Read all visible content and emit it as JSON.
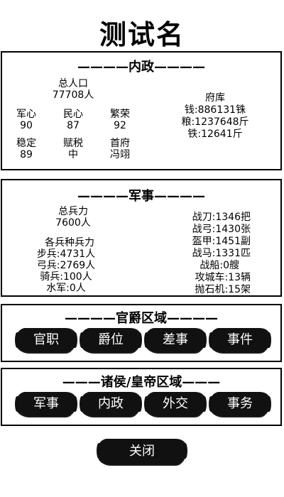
{
  "title": "测试名",
  "neizheng": {
    "header": "————内政————",
    "population_label": "总人口",
    "population_value": "77708人",
    "stats": [
      {
        "label": "军心",
        "value": "90"
      },
      {
        "label": "民心",
        "value": "87"
      },
      {
        "label": "繁荣",
        "value": "92"
      },
      {
        "label": "稳定",
        "value": "89"
      },
      {
        "label": "赋税",
        "value": "中"
      },
      {
        "label": "首府",
        "value": "冯翊"
      }
    ],
    "treasury_label": "府库",
    "treasury": [
      "钱:886131铢",
      "粮:1237648斤",
      "铁:12641斤"
    ]
  },
  "junshi": {
    "header": "————军事————",
    "total_label": "总兵力",
    "total_value": "7600人",
    "branch_label": "各兵种兵力",
    "branches": [
      "步兵:4731人",
      "弓兵:2769人",
      "骑兵:100人",
      "水军:0人"
    ],
    "equipment": [
      "战刀:1346把",
      "战弓:1430张",
      "盔甲:1451副",
      "战马:1331匹",
      "战船:0艘",
      "攻城车:13辆",
      "抛石机:15架"
    ]
  },
  "guanjue": {
    "header": "————官爵区域————",
    "buttons": [
      "官职",
      "爵位",
      "差事",
      "事件"
    ]
  },
  "zhuhou": {
    "header": "———诸侯/皇帝区域———",
    "buttons": [
      "军事",
      "内政",
      "外交",
      "事务"
    ]
  },
  "close_label": "关闭"
}
